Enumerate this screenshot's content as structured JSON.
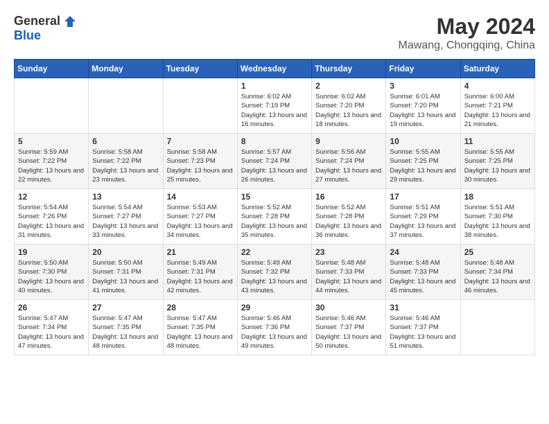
{
  "header": {
    "logo_general": "General",
    "logo_blue": "Blue",
    "month_year": "May 2024",
    "location": "Mawang, Chongqing, China"
  },
  "days_of_week": [
    "Sunday",
    "Monday",
    "Tuesday",
    "Wednesday",
    "Thursday",
    "Friday",
    "Saturday"
  ],
  "weeks": [
    [
      {
        "day": "",
        "info": ""
      },
      {
        "day": "",
        "info": ""
      },
      {
        "day": "",
        "info": ""
      },
      {
        "day": "1",
        "info": "Sunrise: 6:02 AM\nSunset: 7:19 PM\nDaylight: 13 hours and 16 minutes."
      },
      {
        "day": "2",
        "info": "Sunrise: 6:02 AM\nSunset: 7:20 PM\nDaylight: 13 hours and 18 minutes."
      },
      {
        "day": "3",
        "info": "Sunrise: 6:01 AM\nSunset: 7:20 PM\nDaylight: 13 hours and 19 minutes."
      },
      {
        "day": "4",
        "info": "Sunrise: 6:00 AM\nSunset: 7:21 PM\nDaylight: 13 hours and 21 minutes."
      }
    ],
    [
      {
        "day": "5",
        "info": "Sunrise: 5:59 AM\nSunset: 7:22 PM\nDaylight: 13 hours and 22 minutes."
      },
      {
        "day": "6",
        "info": "Sunrise: 5:58 AM\nSunset: 7:22 PM\nDaylight: 13 hours and 23 minutes."
      },
      {
        "day": "7",
        "info": "Sunrise: 5:58 AM\nSunset: 7:23 PM\nDaylight: 13 hours and 25 minutes."
      },
      {
        "day": "8",
        "info": "Sunrise: 5:57 AM\nSunset: 7:24 PM\nDaylight: 13 hours and 26 minutes."
      },
      {
        "day": "9",
        "info": "Sunrise: 5:56 AM\nSunset: 7:24 PM\nDaylight: 13 hours and 27 minutes."
      },
      {
        "day": "10",
        "info": "Sunrise: 5:55 AM\nSunset: 7:25 PM\nDaylight: 13 hours and 29 minutes."
      },
      {
        "day": "11",
        "info": "Sunrise: 5:55 AM\nSunset: 7:25 PM\nDaylight: 13 hours and 30 minutes."
      }
    ],
    [
      {
        "day": "12",
        "info": "Sunrise: 5:54 AM\nSunset: 7:26 PM\nDaylight: 13 hours and 31 minutes."
      },
      {
        "day": "13",
        "info": "Sunrise: 5:54 AM\nSunset: 7:27 PM\nDaylight: 13 hours and 33 minutes."
      },
      {
        "day": "14",
        "info": "Sunrise: 5:53 AM\nSunset: 7:27 PM\nDaylight: 13 hours and 34 minutes."
      },
      {
        "day": "15",
        "info": "Sunrise: 5:52 AM\nSunset: 7:28 PM\nDaylight: 13 hours and 35 minutes."
      },
      {
        "day": "16",
        "info": "Sunrise: 5:52 AM\nSunset: 7:28 PM\nDaylight: 13 hours and 36 minutes."
      },
      {
        "day": "17",
        "info": "Sunrise: 5:51 AM\nSunset: 7:29 PM\nDaylight: 13 hours and 37 minutes."
      },
      {
        "day": "18",
        "info": "Sunrise: 5:51 AM\nSunset: 7:30 PM\nDaylight: 13 hours and 38 minutes."
      }
    ],
    [
      {
        "day": "19",
        "info": "Sunrise: 5:50 AM\nSunset: 7:30 PM\nDaylight: 13 hours and 40 minutes."
      },
      {
        "day": "20",
        "info": "Sunrise: 5:50 AM\nSunset: 7:31 PM\nDaylight: 13 hours and 41 minutes."
      },
      {
        "day": "21",
        "info": "Sunrise: 5:49 AM\nSunset: 7:31 PM\nDaylight: 13 hours and 42 minutes."
      },
      {
        "day": "22",
        "info": "Sunrise: 5:49 AM\nSunset: 7:32 PM\nDaylight: 13 hours and 43 minutes."
      },
      {
        "day": "23",
        "info": "Sunrise: 5:48 AM\nSunset: 7:33 PM\nDaylight: 13 hours and 44 minutes."
      },
      {
        "day": "24",
        "info": "Sunrise: 5:48 AM\nSunset: 7:33 PM\nDaylight: 13 hours and 45 minutes."
      },
      {
        "day": "25",
        "info": "Sunrise: 5:48 AM\nSunset: 7:34 PM\nDaylight: 13 hours and 46 minutes."
      }
    ],
    [
      {
        "day": "26",
        "info": "Sunrise: 5:47 AM\nSunset: 7:34 PM\nDaylight: 13 hours and 47 minutes."
      },
      {
        "day": "27",
        "info": "Sunrise: 5:47 AM\nSunset: 7:35 PM\nDaylight: 13 hours and 48 minutes."
      },
      {
        "day": "28",
        "info": "Sunrise: 5:47 AM\nSunset: 7:35 PM\nDaylight: 13 hours and 48 minutes."
      },
      {
        "day": "29",
        "info": "Sunrise: 5:46 AM\nSunset: 7:36 PM\nDaylight: 13 hours and 49 minutes."
      },
      {
        "day": "30",
        "info": "Sunrise: 5:46 AM\nSunset: 7:37 PM\nDaylight: 13 hours and 50 minutes."
      },
      {
        "day": "31",
        "info": "Sunrise: 5:46 AM\nSunset: 7:37 PM\nDaylight: 13 hours and 51 minutes."
      },
      {
        "day": "",
        "info": ""
      }
    ]
  ]
}
